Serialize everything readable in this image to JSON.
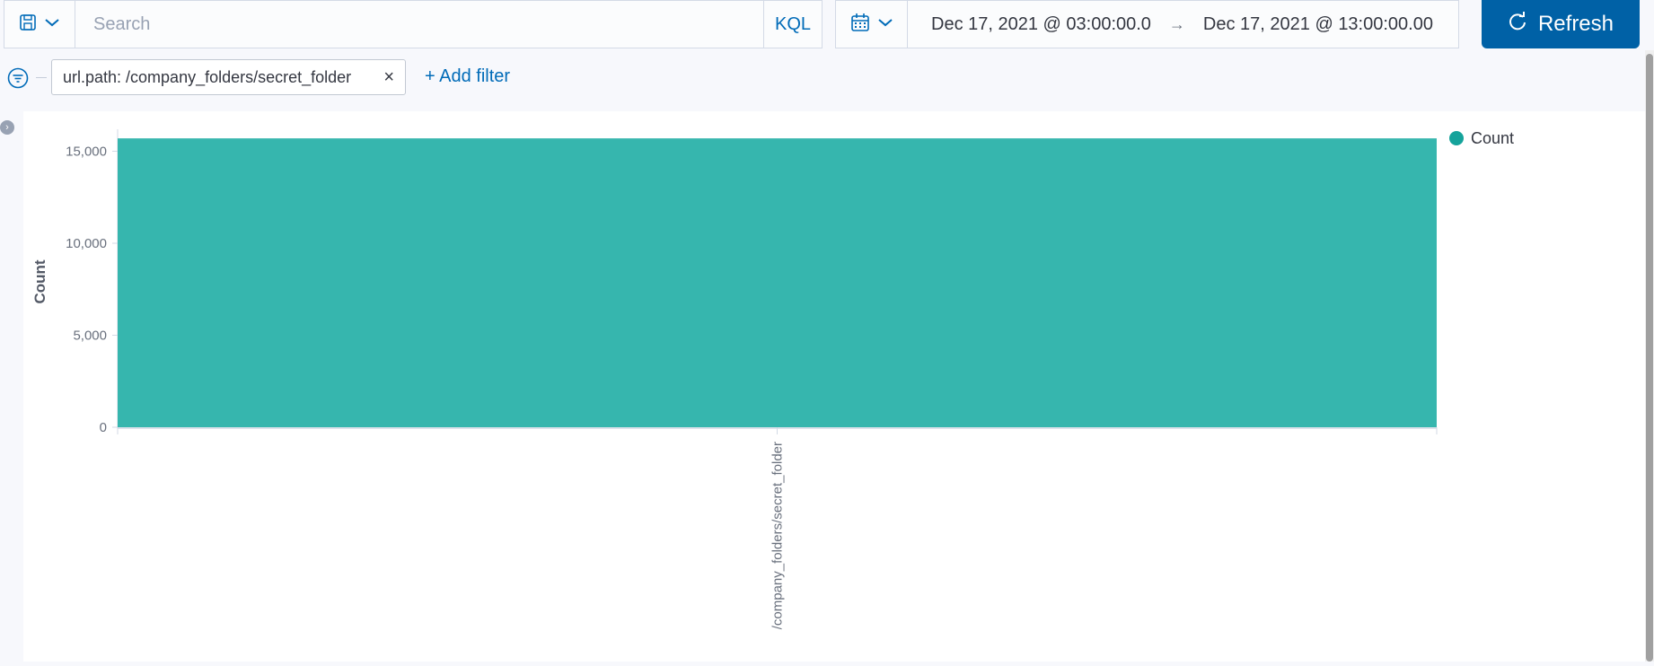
{
  "toolbar": {
    "search_placeholder": "Search",
    "kql_label": "KQL",
    "date_start": "Dec 17, 2021 @ 03:00:00.0",
    "date_arrow": "→",
    "date_end": "Dec 17, 2021 @ 13:00:00.00",
    "refresh_label": "Refresh"
  },
  "filters": {
    "pill_label": "url.path: /company_folders/secret_folder",
    "remove_glyph": "×",
    "add_filter_label": "+ Add filter"
  },
  "colors": {
    "accent": "#006bb8",
    "refresh_bg": "#0061a6",
    "bar": "#36b6ae",
    "legend_dot": "#15a39b"
  },
  "chart_data": {
    "type": "bar",
    "categories": [
      "/company_folders/secret_folder"
    ],
    "series": [
      {
        "name": "Count",
        "values": [
          15700
        ]
      }
    ],
    "ylabel": "Count",
    "xlabel": "",
    "ylim": [
      0,
      16000
    ],
    "yticks": [
      0,
      5000,
      10000,
      15000
    ],
    "ytick_labels": [
      "0",
      "5,000",
      "10,000",
      "15,000"
    ],
    "legend": {
      "position": "top-right",
      "label": "Count"
    },
    "grid": false
  }
}
